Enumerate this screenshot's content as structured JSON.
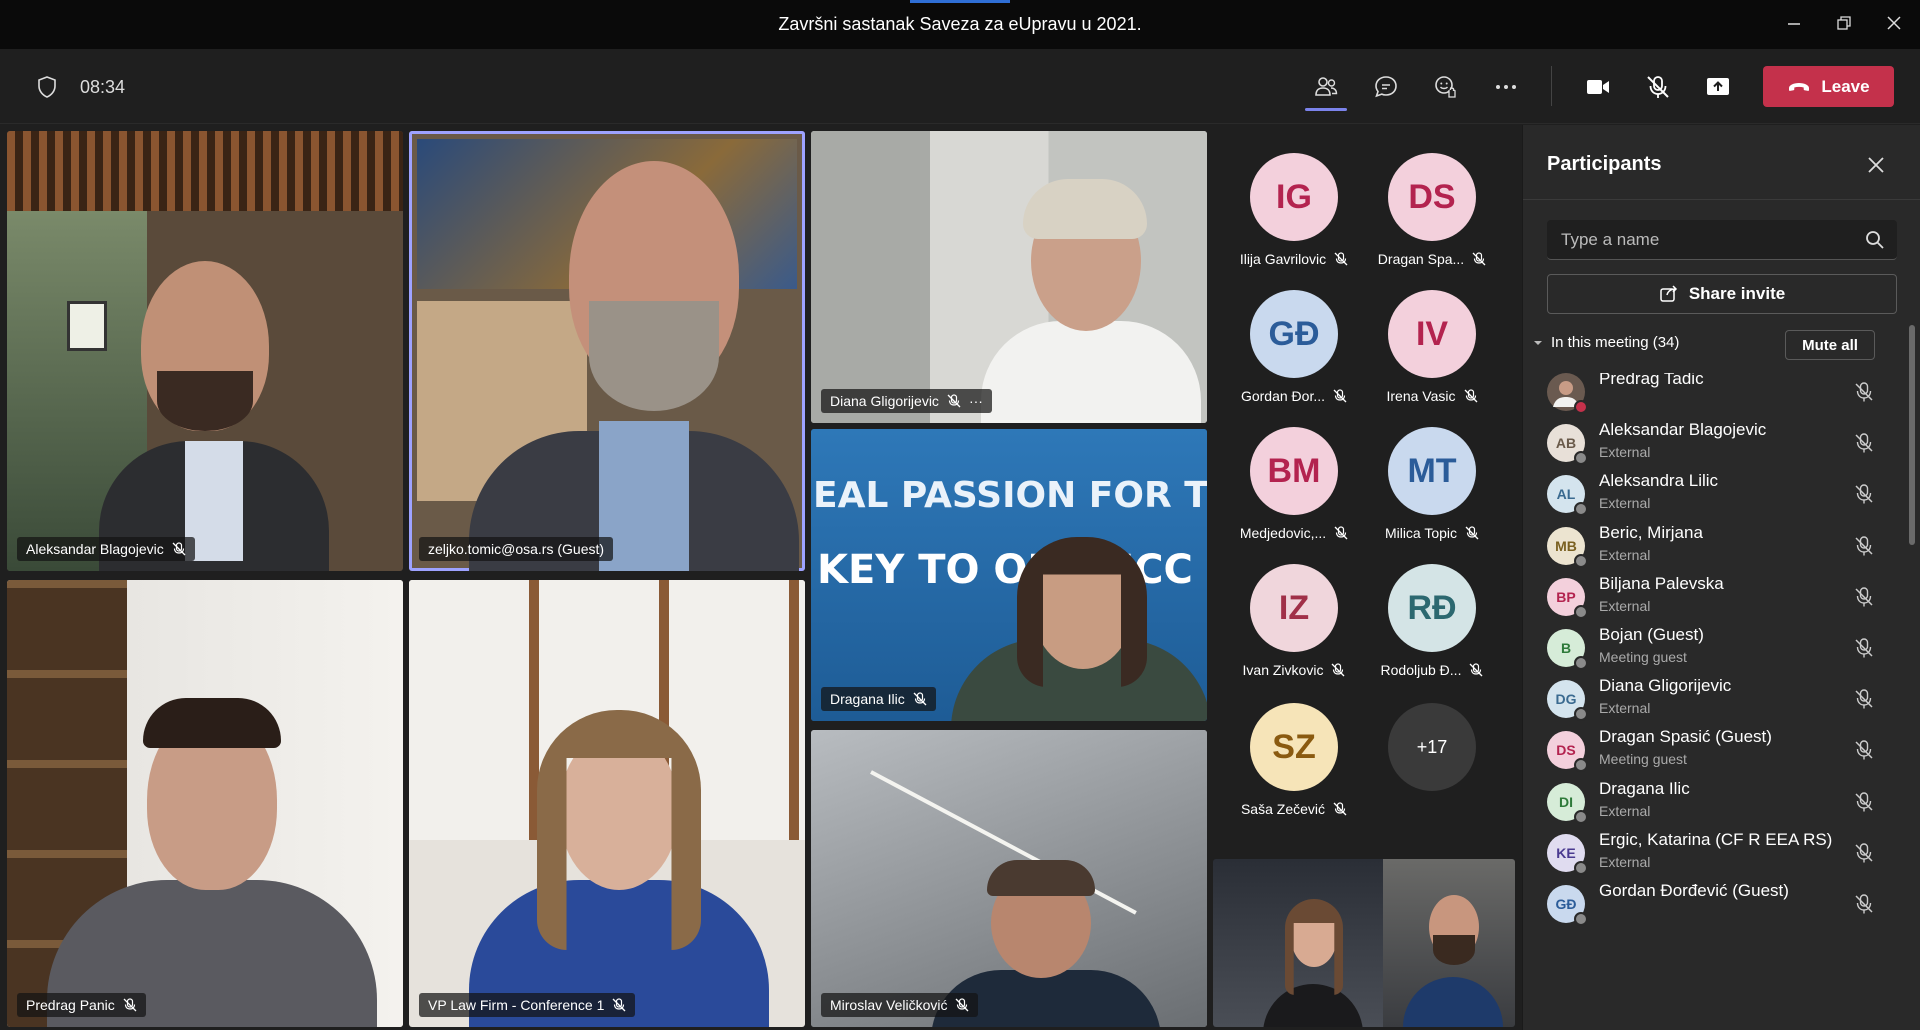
{
  "window": {
    "title": "Završni sastanak Saveza za eUpravu u 2021."
  },
  "toolbar": {
    "timer": "08:34",
    "leave_label": "Leave"
  },
  "tiles": [
    {
      "name": "Aleksandar Blagojevic"
    },
    {
      "name": "zeljko.tomic@osa.rs (Guest)"
    },
    {
      "name": "Diana Gligorijevic",
      "more": "···"
    },
    {
      "name": "Dragana Ilic",
      "banner_top": "EAL PASSION FOR T",
      "banner_bottom": "KEY TO OU   UCC"
    },
    {
      "name": "Predrag Panic"
    },
    {
      "name": "VP Law Firm - Conference 1"
    },
    {
      "name": "Miroslav Veličković"
    }
  ],
  "avatars": [
    {
      "initials": "IG",
      "name": "Ilija Gavrilovic",
      "bg": "#f3d0dc",
      "fg": "#b3234f"
    },
    {
      "initials": "DS",
      "name": "Dragan Spa...",
      "bg": "#f3d0dc",
      "fg": "#b3234f"
    },
    {
      "initials": "GĐ",
      "name": "Gordan Đor...",
      "bg": "#c9d9ee",
      "fg": "#2b5c99"
    },
    {
      "initials": "IV",
      "name": "Irena Vasic",
      "bg": "#f3d0dc",
      "fg": "#b3234f"
    },
    {
      "initials": "BM",
      "name": "Medjedovic,...",
      "bg": "#f3d0dc",
      "fg": "#b3234f"
    },
    {
      "initials": "MT",
      "name": "Milica Topic",
      "bg": "#c9d9ee",
      "fg": "#2b5c99"
    },
    {
      "initials": "IZ",
      "name": "Ivan Zivkovic",
      "bg": "#f0d6dc",
      "fg": "#a03048"
    },
    {
      "initials": "RĐ",
      "name": "Rodoljub Đ...",
      "bg": "#d4e4e6",
      "fg": "#2c6870"
    },
    {
      "initials": "SZ",
      "name": "Saša Zečević",
      "bg": "#f6e4b8",
      "fg": "#8a5a10"
    }
  ],
  "overflow": {
    "label": "+17"
  },
  "panel": {
    "title": "Participants",
    "search_placeholder": "Type a name",
    "share_label": "Share invite",
    "section_label": "In this meeting (34)",
    "mute_all_label": "Mute all",
    "participants": [
      {
        "initials": "",
        "name": "Predrag Tadic",
        "sub": "",
        "bg": "#5a4a40",
        "fg": "#fff",
        "status": "#c4314b"
      },
      {
        "initials": "AB",
        "name": "Aleksandar Blagojevic",
        "sub": "External",
        "bg": "#e8e0d8",
        "fg": "#6a5a4a",
        "status": "#8a8a8a"
      },
      {
        "initials": "AL",
        "name": "Aleksandra Lilic",
        "sub": "External",
        "bg": "#d4e4ee",
        "fg": "#3a6a90",
        "status": "#8a8a8a"
      },
      {
        "initials": "MB",
        "name": "Beric, Mirjana",
        "sub": "External",
        "bg": "#ece4d0",
        "fg": "#7a6020",
        "status": "#8a8a8a"
      },
      {
        "initials": "BP",
        "name": "Biljana Palevska",
        "sub": "External",
        "bg": "#f3d0dc",
        "fg": "#b3234f",
        "status": "#8a8a8a"
      },
      {
        "initials": "B",
        "name": "Bojan (Guest)",
        "sub": "Meeting guest",
        "bg": "#d6ecd8",
        "fg": "#2e7a3a",
        "status": "#8a8a8a"
      },
      {
        "initials": "DG",
        "name": "Diana Gligorijevic",
        "sub": "External",
        "bg": "#d4e4ee",
        "fg": "#3a6a90",
        "status": "#8a8a8a"
      },
      {
        "initials": "DS",
        "name": "Dragan Spasić (Guest)",
        "sub": "Meeting guest",
        "bg": "#f3d0dc",
        "fg": "#b3234f",
        "status": "#8a8a8a"
      },
      {
        "initials": "DI",
        "name": "Dragana Ilic",
        "sub": "External",
        "bg": "#d6ecd8",
        "fg": "#2e7a3a",
        "status": "#8a8a8a"
      },
      {
        "initials": "KE",
        "name": "Ergic, Katarina (CF R EEA RS)",
        "sub": "External",
        "bg": "#e0dcf0",
        "fg": "#4a3a90",
        "status": "#8a8a8a"
      },
      {
        "initials": "GĐ",
        "name": "Gordan Đorđević (Guest)",
        "sub": "",
        "bg": "#c9d9ee",
        "fg": "#2b5c99",
        "status": "#8a8a8a"
      }
    ]
  },
  "colors": {
    "accent": "#7b83eb",
    "leave": "#c4314b",
    "active_border": "#9ea2ff"
  }
}
